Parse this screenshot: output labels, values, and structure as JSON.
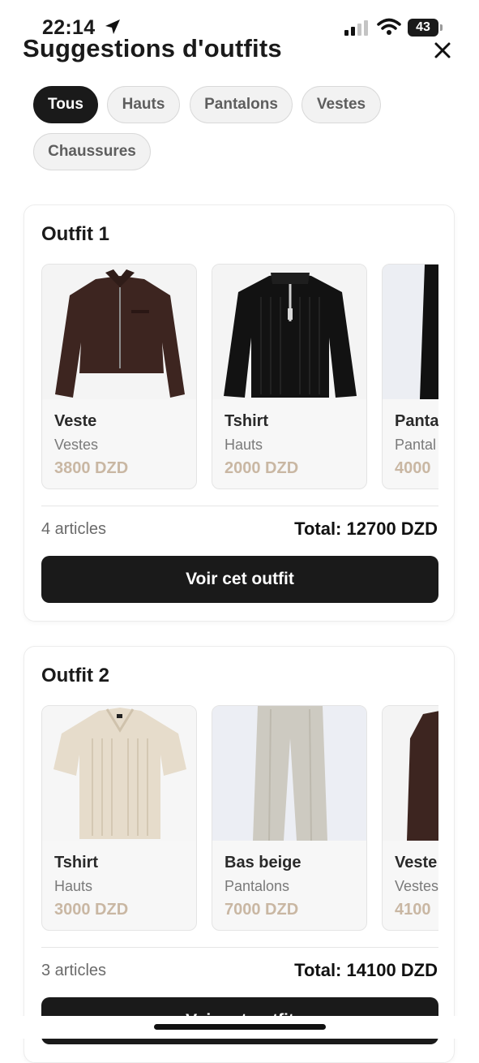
{
  "status": {
    "time": "22:14",
    "battery": "43"
  },
  "header": {
    "title": "Suggestions d'outfits"
  },
  "filters": [
    "Tous",
    "Hauts",
    "Pantalons",
    "Vestes",
    "Chaussures"
  ],
  "outfits": [
    {
      "title": "Outfit 1",
      "items": [
        {
          "name": "Veste",
          "category": "Vestes",
          "price": "3800 DZD",
          "icon": "brown-jacket-image"
        },
        {
          "name": "Tshirt",
          "category": "Hauts",
          "price": "2000 DZD",
          "icon": "black-sweater-image"
        },
        {
          "name": "Panta",
          "category": "Pantal",
          "price": "4000",
          "icon": "black-pants-image"
        }
      ],
      "count": "4 articles",
      "total": "Total: 12700 DZD",
      "button": "Voir cet outfit"
    },
    {
      "title": "Outfit 2",
      "items": [
        {
          "name": "Tshirt",
          "category": "Hauts",
          "price": "3000 DZD",
          "icon": "beige-polo-image"
        },
        {
          "name": "Bas beige",
          "category": "Pantalons",
          "price": "7000 DZD",
          "icon": "beige-pants-image"
        },
        {
          "name": "Veste",
          "category": "Vestes",
          "price": "4100",
          "icon": "brown-jacket-image"
        }
      ],
      "count": "3 articles",
      "total": "Total: 14100 DZD",
      "button": "Voir cet outfit"
    }
  ],
  "colors": {
    "accent": "#1a1a1a",
    "price": "#c9b7a3",
    "chip_bg": "#f2f2f2"
  }
}
